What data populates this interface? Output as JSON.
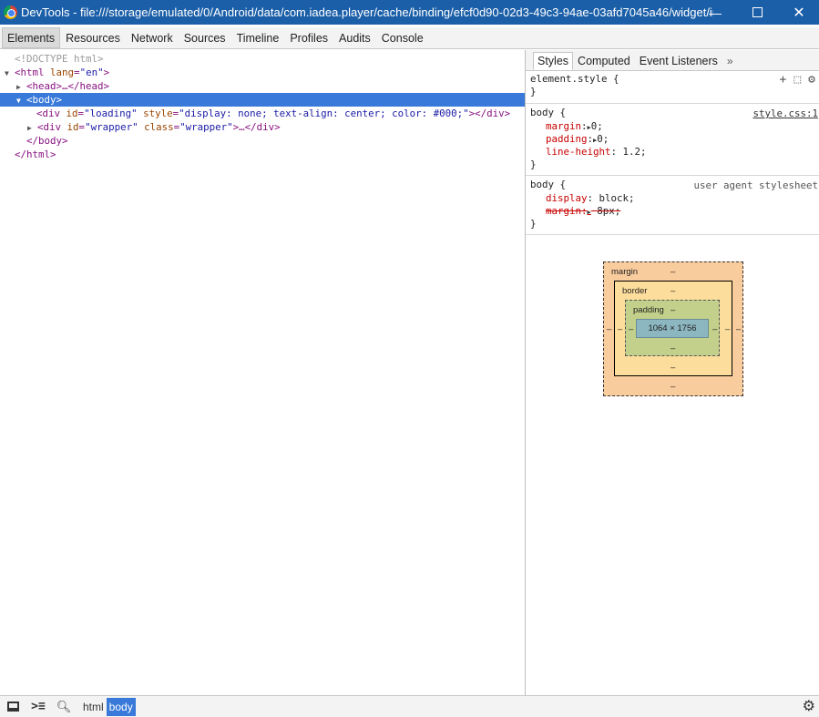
{
  "window": {
    "title": "DevTools - file:///storage/emulated/0/Android/data/com.iadea.player/cache/binding/efcf0d90-02d3-49c3-94ae-03afd7045a46/widget/ind...",
    "min_glyph": "—",
    "close_glyph": "✕"
  },
  "tabs": [
    "Elements",
    "Resources",
    "Network",
    "Sources",
    "Timeline",
    "Profiles",
    "Audits",
    "Console"
  ],
  "dom": {
    "doctype": "<!DOCTYPE html>",
    "html_open": "<html",
    "html_attr": "lang",
    "html_attr_val": "\"en\"",
    "html_close_bracket": ">",
    "head": "<head>…</head>",
    "body_open": "<body>",
    "div1_open": "<div",
    "div1_id_attr": "id",
    "div1_id_val": "\"loading\"",
    "div1_style_attr": "style",
    "div1_style_val": "\"display: none; text-align: center; color: #000;\"",
    "div1_close": "></div>",
    "div2_open": "<div",
    "div2_id_attr": "id",
    "div2_id_val": "\"wrapper\"",
    "div2_class_attr": "class",
    "div2_class_val": "\"wrapper\"",
    "div2_close": ">…</div>",
    "body_close": "</body>",
    "html_close": "</html>"
  },
  "sidebar": {
    "tabs": [
      "Styles",
      "Computed",
      "Event Listeners"
    ],
    "more": "»",
    "element_style": {
      "selector": "element.style {",
      "close": "}"
    },
    "body_rule": {
      "selector": "body {",
      "source": "style.css:1",
      "props": [
        {
          "name": "margin",
          "value": "0;"
        },
        {
          "name": "padding",
          "value": "0;"
        },
        {
          "name": "line-height",
          "value": "1.2;"
        }
      ],
      "close": "}"
    },
    "ua_rule": {
      "selector": "body {",
      "source": "user agent stylesheet",
      "display_name": "display",
      "display_value": "block;",
      "margin_name": "margin",
      "margin_value": "8px;",
      "close": "}"
    }
  },
  "boxmodel": {
    "margin_label": "margin",
    "border_label": "border",
    "padding_label": "padding",
    "dash": "–",
    "content": "1064 × 1756"
  },
  "breadcrumbs": [
    "html",
    "body"
  ]
}
